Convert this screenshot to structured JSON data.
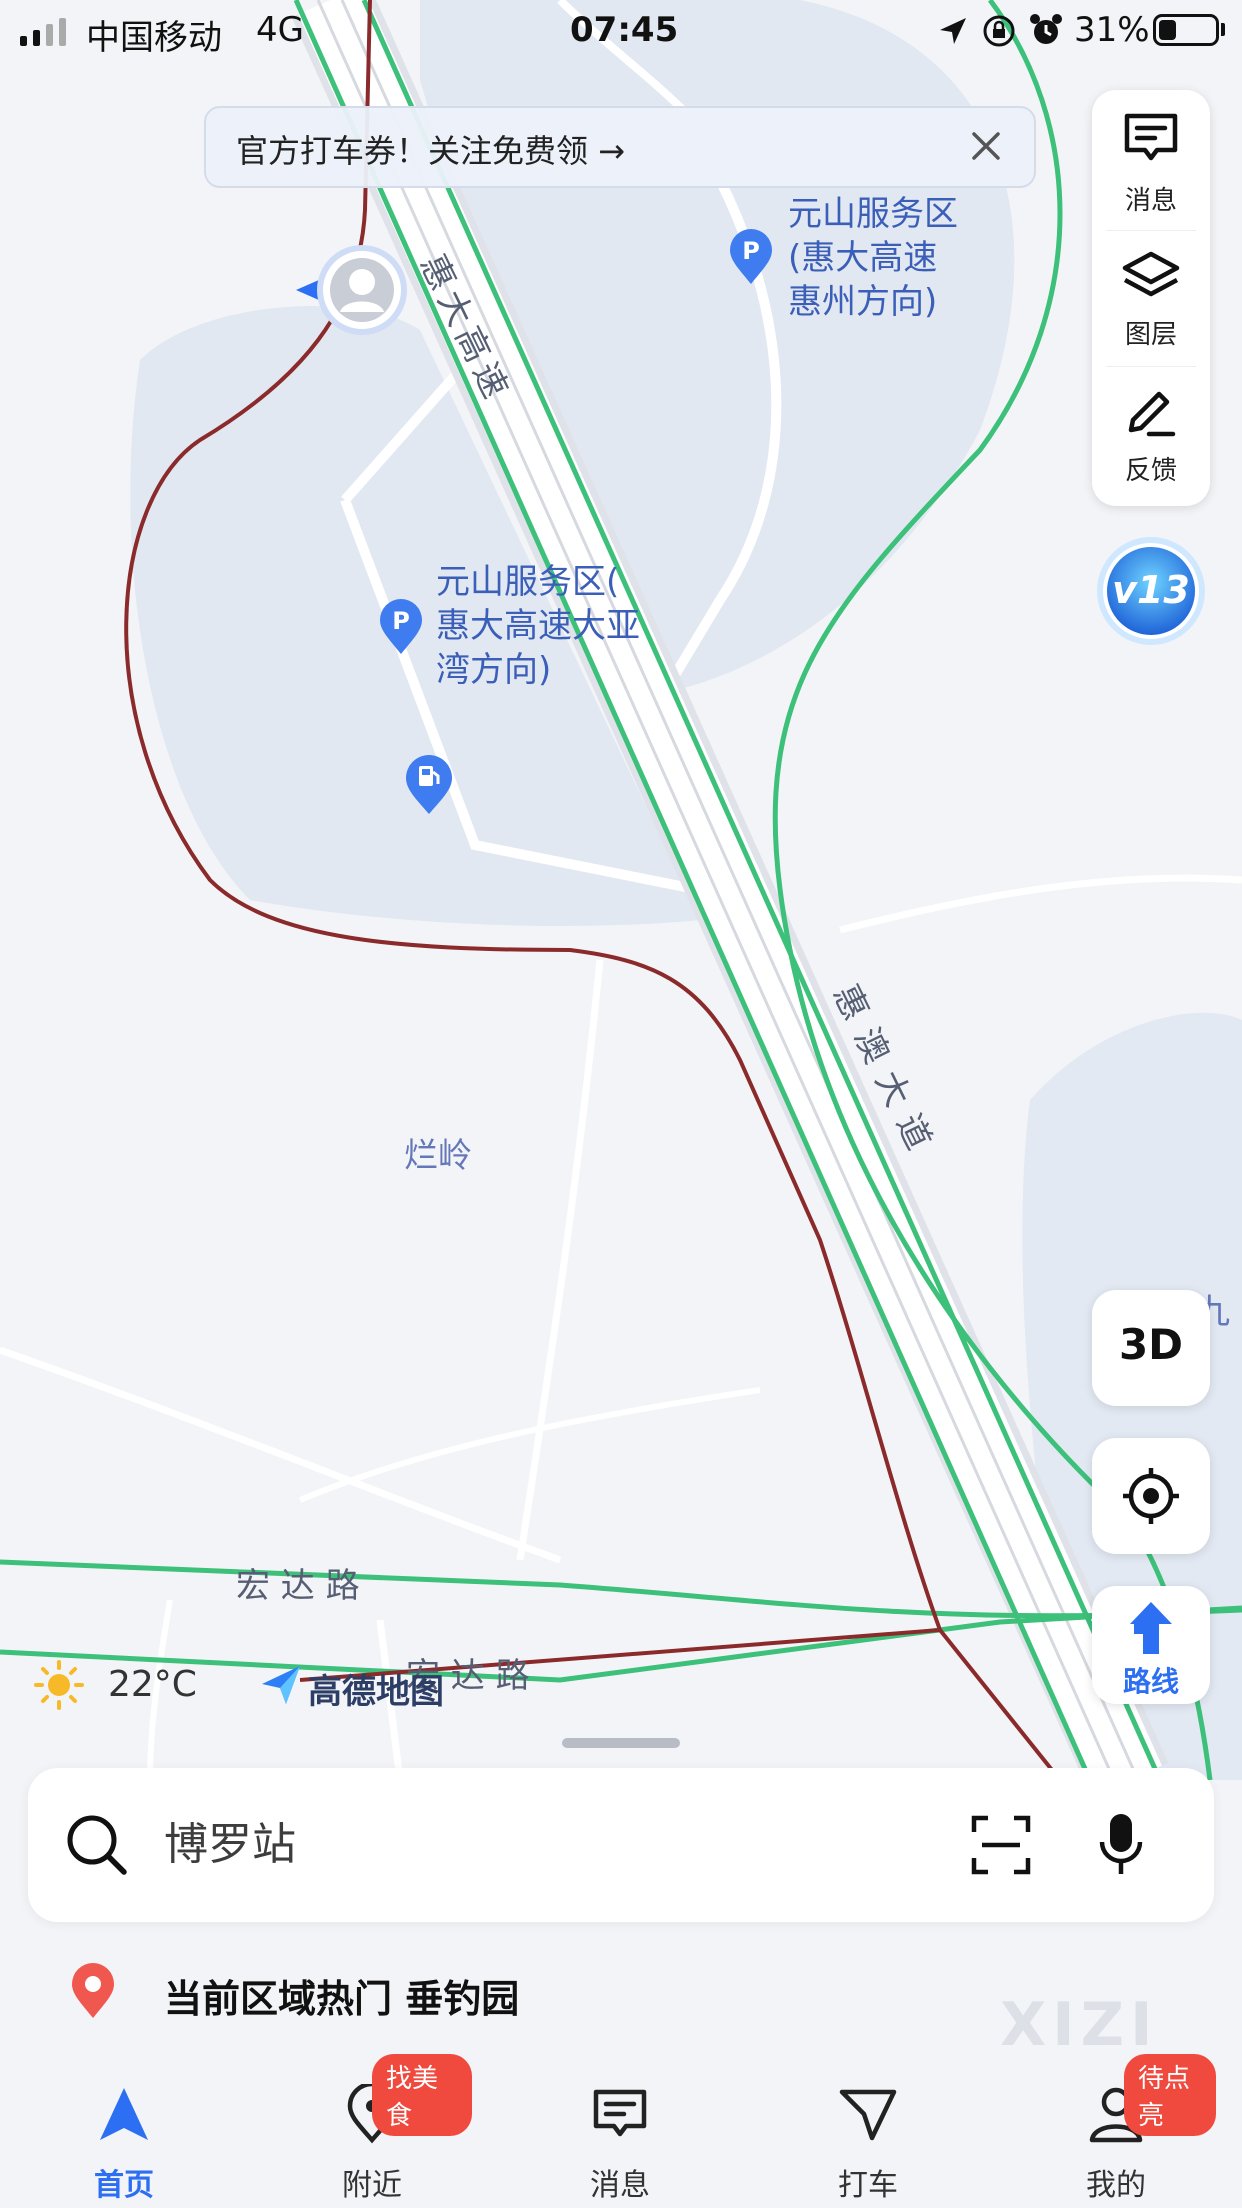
{
  "status_bar": {
    "carrier": "中国移动",
    "network": "4G",
    "time": "07:45",
    "battery_percent": "31%",
    "battery_level": 0.31
  },
  "promo_banner": {
    "text": "官方打车券！关注免费领 →",
    "close_icon": "close-icon"
  },
  "map": {
    "poi_1": [
      "元山服务区",
      "(惠大高速",
      "惠州方向)"
    ],
    "poi_2": [
      "元山服务区(",
      "惠大高速大亚",
      "湾方向)"
    ],
    "road_expressway": "惠大高速",
    "road_avenue": "惠澳大道",
    "place_lanling": "烂岭",
    "road_hongda_1": "宏 达 路",
    "road_hongda_2": "宏 达 路",
    "edge_label": "九",
    "badge_text": "v13",
    "weather": {
      "temp": "22°C",
      "icon": "sun-icon"
    },
    "brand": "高德地图"
  },
  "tools": {
    "messages": "消息",
    "layers": "图层",
    "feedback": "反馈",
    "view_3d": "3D",
    "route": "路线"
  },
  "search": {
    "placeholder": "博罗站",
    "search_icon": "search-icon",
    "scan_icon": "scan-icon",
    "mic_icon": "microphone-icon"
  },
  "hot": {
    "text": "当前区域热门 垂钓园",
    "icon": "location-pin-icon"
  },
  "watermark": "XIZI",
  "tabs": [
    {
      "label": "首页",
      "icon": "navigation-arrow-icon",
      "active": true
    },
    {
      "label": "附近",
      "icon": "nearby-pin-icon",
      "badge": "找美食"
    },
    {
      "label": "消息",
      "icon": "message-icon"
    },
    {
      "label": "打车",
      "icon": "taxi-icon"
    },
    {
      "label": "我的",
      "icon": "profile-icon",
      "badge": "待点亮"
    }
  ],
  "colors": {
    "accent": "#2d6ff2",
    "badge": "#f04a3e",
    "route_red": "#8b2a2a",
    "road_green": "#3cc07a"
  }
}
